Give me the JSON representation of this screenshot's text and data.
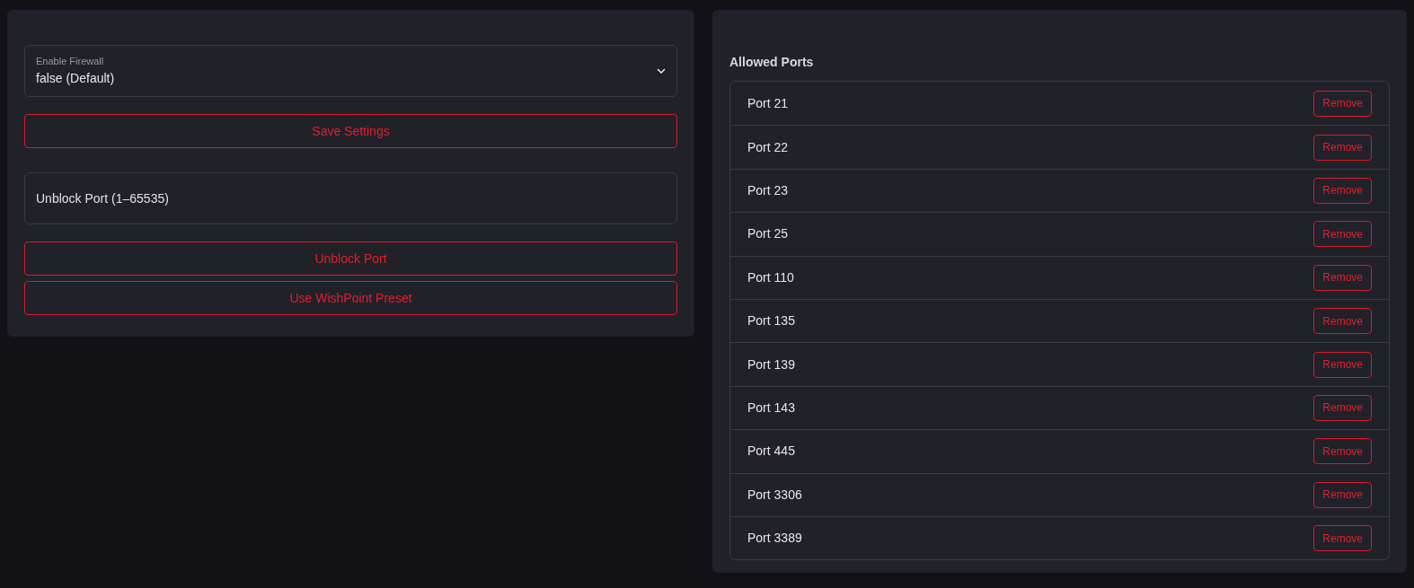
{
  "settings": {
    "firewall_select": {
      "label": "Enable Firewall",
      "value": "false (Default)"
    },
    "save_button": "Save Settings",
    "port_input": {
      "placeholder": "Unblock Port (1–65535)"
    },
    "buttons": [
      "Unblock Port",
      "Use WishPoint Preset"
    ]
  },
  "allowed_ports": {
    "title": "Allowed Ports",
    "rows": [
      {
        "label": "Port 21",
        "action": "Remove"
      },
      {
        "label": "Port 22",
        "action": "Remove"
      },
      {
        "label": "Port 23",
        "action": "Remove"
      },
      {
        "label": "Port 25",
        "action": "Remove"
      },
      {
        "label": "Port 110",
        "action": "Remove"
      },
      {
        "label": "Port 135",
        "action": "Remove"
      },
      {
        "label": "Port 139",
        "action": "Remove"
      },
      {
        "label": "Port 143",
        "action": "Remove"
      },
      {
        "label": "Port 445",
        "action": "Remove"
      },
      {
        "label": "Port 3306",
        "action": "Remove"
      },
      {
        "label": "Port 3389",
        "action": "Remove"
      }
    ]
  }
}
